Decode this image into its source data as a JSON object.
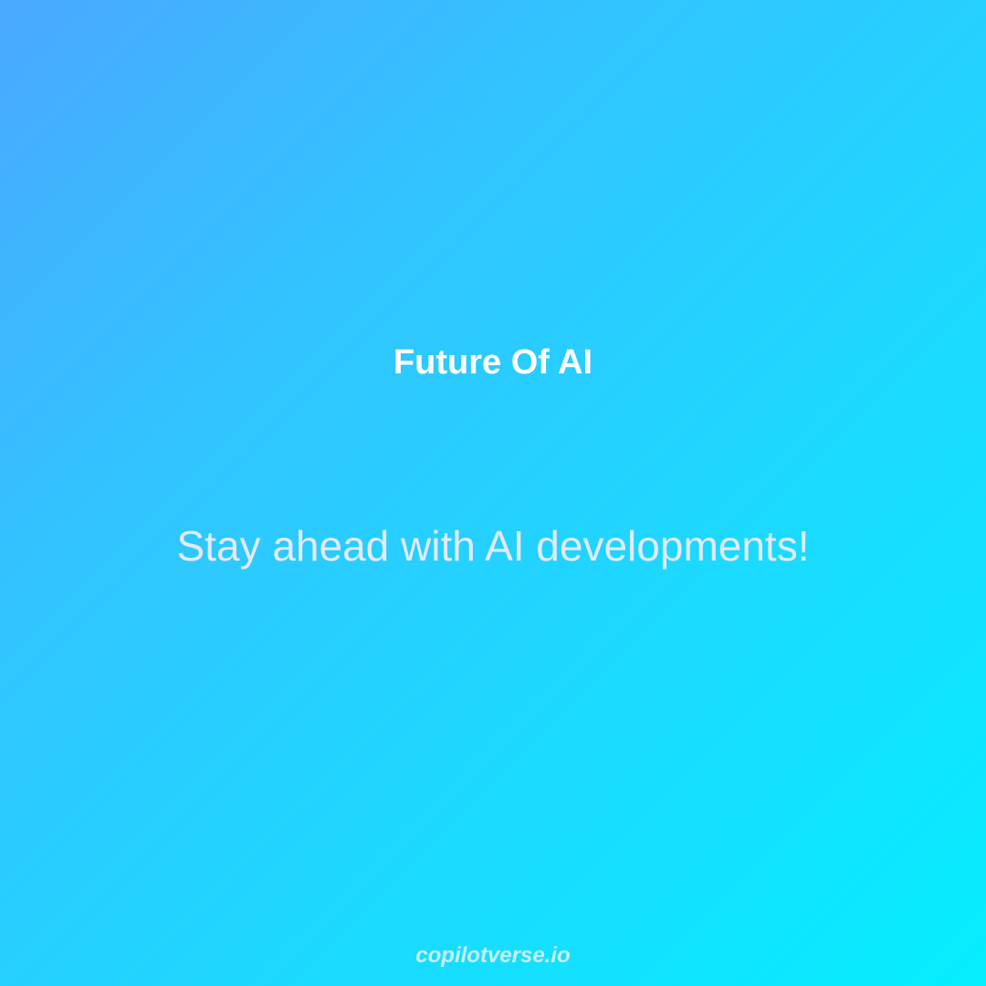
{
  "post": {
    "title": "Future Of AI",
    "subtitle": "Stay ahead with AI developments!",
    "footer": "copilotverse.io"
  },
  "colors": {
    "gradient_start": "#4aa8ff",
    "gradient_end": "#05eeff",
    "title": "#ffffff",
    "subtitle": "#e3eaf6",
    "footer": "#c6f1fb"
  }
}
